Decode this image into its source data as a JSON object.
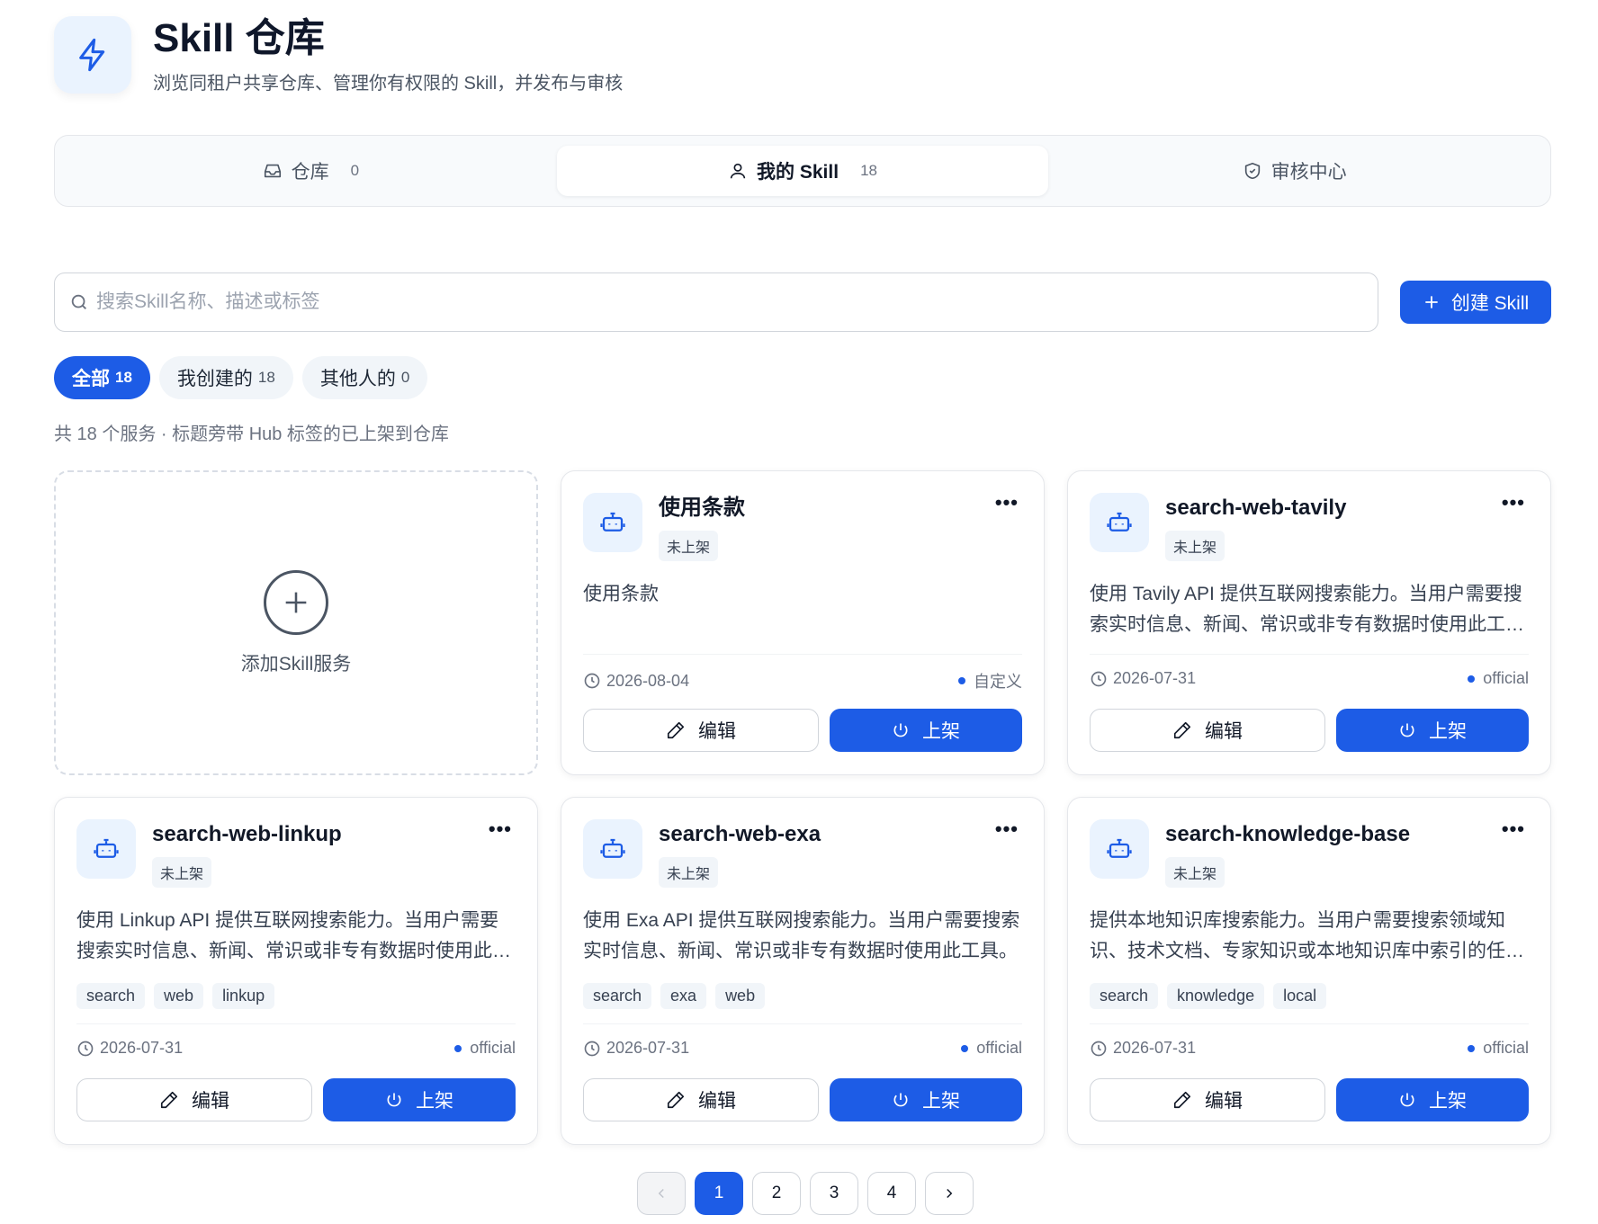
{
  "header": {
    "title": "Skill 仓库",
    "subtitle": "浏览同租户共享仓库、管理你有权限的 Skill，并发布与审核",
    "icon": "lightning-icon"
  },
  "tabs": [
    {
      "label": "仓库",
      "count": "0",
      "icon": "inbox-icon",
      "active": false
    },
    {
      "label": "我的 Skill",
      "count": "18",
      "icon": "user-icon",
      "active": true
    },
    {
      "label": "审核中心",
      "count": "",
      "icon": "shield-check-icon",
      "active": false
    }
  ],
  "search": {
    "placeholder": "搜索Skill名称、描述或标签",
    "value": ""
  },
  "create_button": "创建 Skill",
  "filters": [
    {
      "label": "全部",
      "count": "18",
      "active": true
    },
    {
      "label": "我创建的",
      "count": "18",
      "active": false
    },
    {
      "label": "其他人的",
      "count": "0",
      "active": false
    }
  ],
  "summary": "共 18 个服务 · 标题旁带 Hub 标签的已上架到仓库",
  "add_card": {
    "label": "添加Skill服务"
  },
  "cards": [
    {
      "name": "使用条款",
      "status": "未上架",
      "desc": "使用条款",
      "tags": [],
      "date": "2026-08-04",
      "source": "自定义",
      "edit": "编辑",
      "publish": "上架"
    },
    {
      "name": "search-web-tavily",
      "status": "未上架",
      "desc": "使用 Tavily API 提供互联网搜索能力。当用户需要搜索实时信息、新闻、常识或非专有数据时使用此工具。",
      "tags": [],
      "date": "2026-07-31",
      "source": "official",
      "edit": "编辑",
      "publish": "上架"
    },
    {
      "name": "search-web-linkup",
      "status": "未上架",
      "desc": "使用 Linkup API 提供互联网搜索能力。当用户需要搜索实时信息、新闻、常识或非专有数据时使用此工具。",
      "tags": [
        "search",
        "web",
        "linkup"
      ],
      "date": "2026-07-31",
      "source": "official",
      "edit": "编辑",
      "publish": "上架"
    },
    {
      "name": "search-web-exa",
      "status": "未上架",
      "desc": "使用 Exa API 提供互联网搜索能力。当用户需要搜索实时信息、新闻、常识或非专有数据时使用此工具。",
      "tags": [
        "search",
        "exa",
        "web"
      ],
      "date": "2026-07-31",
      "source": "official",
      "edit": "编辑",
      "publish": "上架"
    },
    {
      "name": "search-knowledge-base",
      "status": "未上架",
      "desc": "提供本地知识库搜索能力。当用户需要搜索领域知识、技术文档、专家知识或本地知识库中索引的任何内容时使用。",
      "tags": [
        "search",
        "knowledge",
        "local"
      ],
      "date": "2026-07-31",
      "source": "official",
      "edit": "编辑",
      "publish": "上架"
    }
  ],
  "pagination": {
    "pages": [
      "1",
      "2",
      "3",
      "4"
    ],
    "current": "1"
  },
  "colors": {
    "accent": "#1d5ce6",
    "icon_bg": "#eaf3fe"
  }
}
